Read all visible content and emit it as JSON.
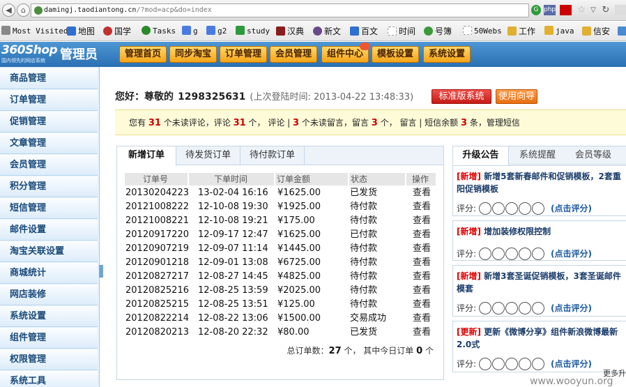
{
  "browser": {
    "url_host": "damingj.taodiantong.cn",
    "url_path": "/?mod=acp&do=index",
    "ext_php": "php"
  },
  "bookmarks": [
    {
      "label": "Most Visited",
      "color": "#888888"
    },
    {
      "label": "地图",
      "color": "#2f6fd0"
    },
    {
      "label": "国学",
      "color": "#c23030"
    },
    {
      "label": "Tasks",
      "color": "#2a8a2a"
    },
    {
      "label": "g",
      "color": "#4a7be0"
    },
    {
      "label": "g2",
      "color": "#4a7be0"
    },
    {
      "label": "study",
      "color": "#2c9a3c"
    },
    {
      "label": "汉典",
      "color": "#8a1c1c"
    },
    {
      "label": "新文",
      "color": "#6a4a8a"
    },
    {
      "label": "百文",
      "color": "#2f6fd0"
    },
    {
      "label": "时间",
      "color": "#999999"
    },
    {
      "label": "号簿",
      "color": "#3a9a3a"
    },
    {
      "label": "50Webs",
      "color": "#999999"
    },
    {
      "label": "工作",
      "color": "#e0b030"
    },
    {
      "label": "java",
      "color": "#e0b030"
    },
    {
      "label": "信安",
      "color": "#e0b030"
    }
  ],
  "header": {
    "brand": "360Shop",
    "slogan": "国内领先的网店系统",
    "admin": "管理员",
    "nav": [
      "管理首页",
      "同步淘宝",
      "订单管理",
      "会员管理",
      "组件中心",
      "模板设置",
      "系统设置"
    ]
  },
  "sidebar": [
    "商品管理",
    "订单管理",
    "促销管理",
    "文章管理",
    "会员管理",
    "积分管理",
    "短信管理",
    "邮件设置",
    "淘宝关联设置",
    "商城统计",
    "网店装修",
    "系统设置",
    "组件管理",
    "权限管理",
    "系统工具"
  ],
  "greeting": {
    "hello": "您好：尊敬的",
    "user": "1298325631",
    "last_login": "(上次登陆时间: 2013-04-22 13:48:33)",
    "btn_standard": "标准版系统",
    "btn_guide": "使用向导"
  },
  "notice": {
    "p1": "您有",
    "n1": "31",
    "p2": "个未读评论，评论",
    "n2": "31",
    "p3": "个，  评论 |",
    "n3": "3",
    "p4": "个未读留言，留言",
    "n4": "3",
    "p5": "个，  留言  | 短信余额",
    "n5": "3",
    "p6": "条，管理短信"
  },
  "orders": {
    "tabs": [
      "新增订单",
      "待发货订单",
      "待付款订单"
    ],
    "columns": [
      "订单号",
      "下单时间",
      "订单金额",
      "状态",
      "操作"
    ],
    "rows": [
      [
        "20130204223",
        "13-02-04 16:16",
        "¥1625.00",
        "已发货",
        "查看"
      ],
      [
        "20121008222",
        "12-10-08 19:30",
        "¥1925.00",
        "待付款",
        "查看"
      ],
      [
        "20121008221",
        "12-10-08 19:21",
        "¥175.00",
        "待付款",
        "查看"
      ],
      [
        "20120917220",
        "12-09-17 12:47",
        "¥1625.00",
        "已付款",
        "查看"
      ],
      [
        "20120907219",
        "12-09-07 11:14",
        "¥1445.00",
        "待付款",
        "查看"
      ],
      [
        "20120901218",
        "12-09-01 13:08",
        "¥6725.00",
        "待付款",
        "查看"
      ],
      [
        "20120827217",
        "12-08-27 14:45",
        "¥4825.00",
        "待付款",
        "查看"
      ],
      [
        "20120825216",
        "12-08-25 13:59",
        "¥2025.00",
        "待付款",
        "查看"
      ],
      [
        "20120825215",
        "12-08-25 13:51",
        "¥125.00",
        "待付款",
        "查看"
      ],
      [
        "20120822214",
        "12-08-22 13:06",
        "¥1500.00",
        "交易成功",
        "查看"
      ],
      [
        "20120820213",
        "12-08-20 22:32",
        "¥80.00",
        "已发货",
        "查看"
      ]
    ],
    "total_prefix": "总订单数：",
    "total_count": "27",
    "total_mid": "个，  其中今日订单",
    "today_count": "0",
    "total_suffix": "个"
  },
  "announcements": {
    "tabs": [
      "升级公告",
      "系统提醒",
      "会员等级"
    ],
    "rate_label": "评分:",
    "rate_link": "(点击评分)",
    "items": [
      {
        "tag": "[新增]",
        "text": "新增5套新春邮件和促销模板，2套重阳促销模板"
      },
      {
        "tag": "[新增]",
        "text": "增加装修权限控制"
      },
      {
        "tag": "[新增]",
        "text": "新增3套圣诞促销模板，3套圣诞邮件模套"
      },
      {
        "tag": "[更新]",
        "text": "更新《微博分享》组件新浪微博最新2.0式"
      }
    ],
    "more": "更多升"
  },
  "watermark": "www.wooyun.org"
}
